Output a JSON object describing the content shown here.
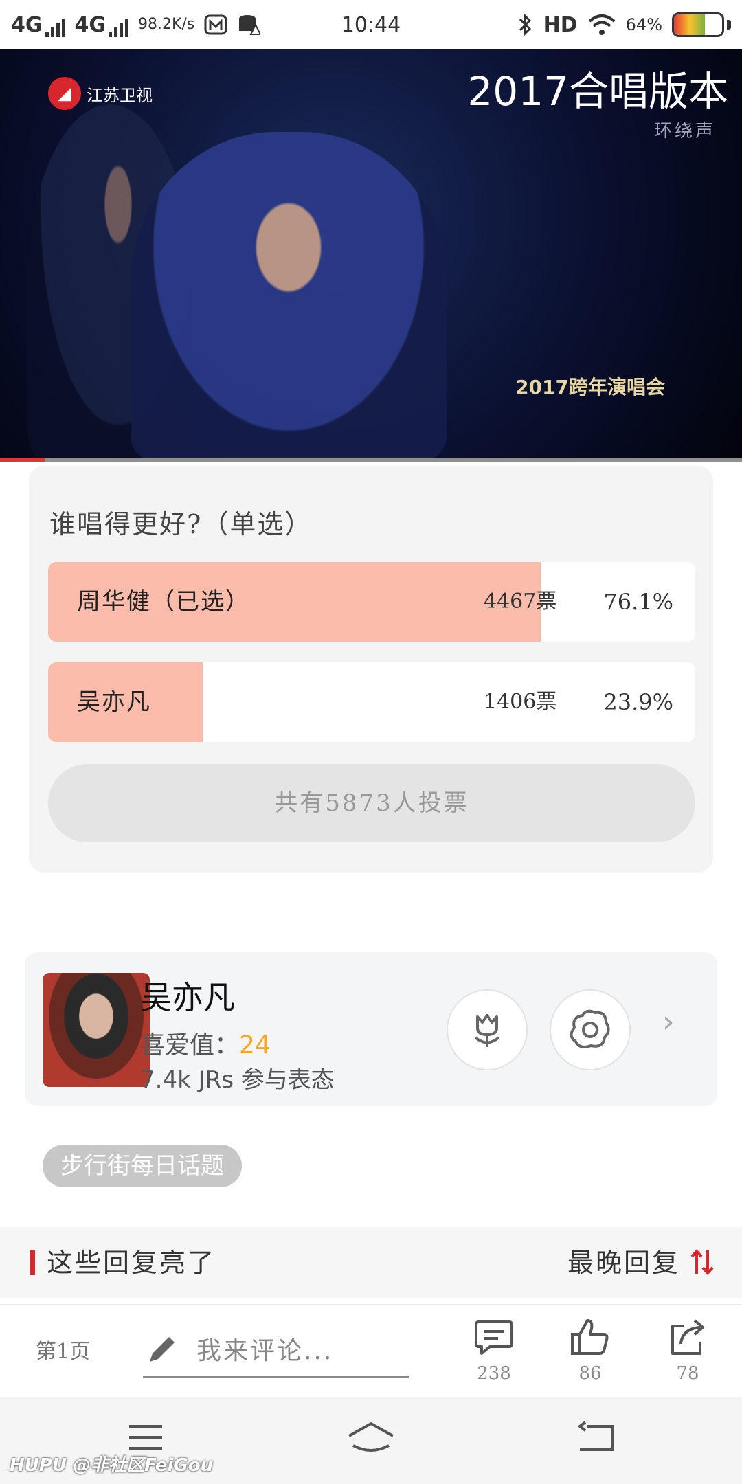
{
  "status_bar": {
    "network1": "4G",
    "network2": "4G",
    "speed": "98.2K/s",
    "time": "10:44",
    "hd": "HD",
    "battery": "64%",
    "battery_level": 0.64
  },
  "video": {
    "title_overlay": "2017合唱版本",
    "channel_logo": "江苏卫视",
    "sub_text": "环绕声",
    "event_text": "2017跨年演唱会",
    "progress": 0.06
  },
  "poll": {
    "question": "谁唱得更好?（单选）",
    "options": [
      {
        "name": "周华健（已选）",
        "votes": "4467票",
        "percent": "76.1%",
        "fraction": 0.761
      },
      {
        "name": "吴亦凡",
        "votes": "1406票",
        "percent": "23.9%",
        "fraction": 0.239
      }
    ],
    "total": "共有5873人投票"
  },
  "topic_card": {
    "name": "吴亦凡",
    "fav_label": "喜爱值：",
    "fav_value": "24",
    "participants": "7.4k JRs 参与表态"
  },
  "tag": "步行街每日话题",
  "replies": {
    "title": "这些回复亮了",
    "sort": "最晚回复"
  },
  "comment_bar": {
    "page": "第1页",
    "placeholder": "我来评论...",
    "comments_count": "238",
    "likes_count": "86",
    "shares_count": "78"
  },
  "watermark": "HUPU @非社区FeiGou",
  "colors": {
    "accent_red": "#d7262c",
    "poll_fill": "#fcbcab",
    "fav_orange": "#f5a623"
  }
}
